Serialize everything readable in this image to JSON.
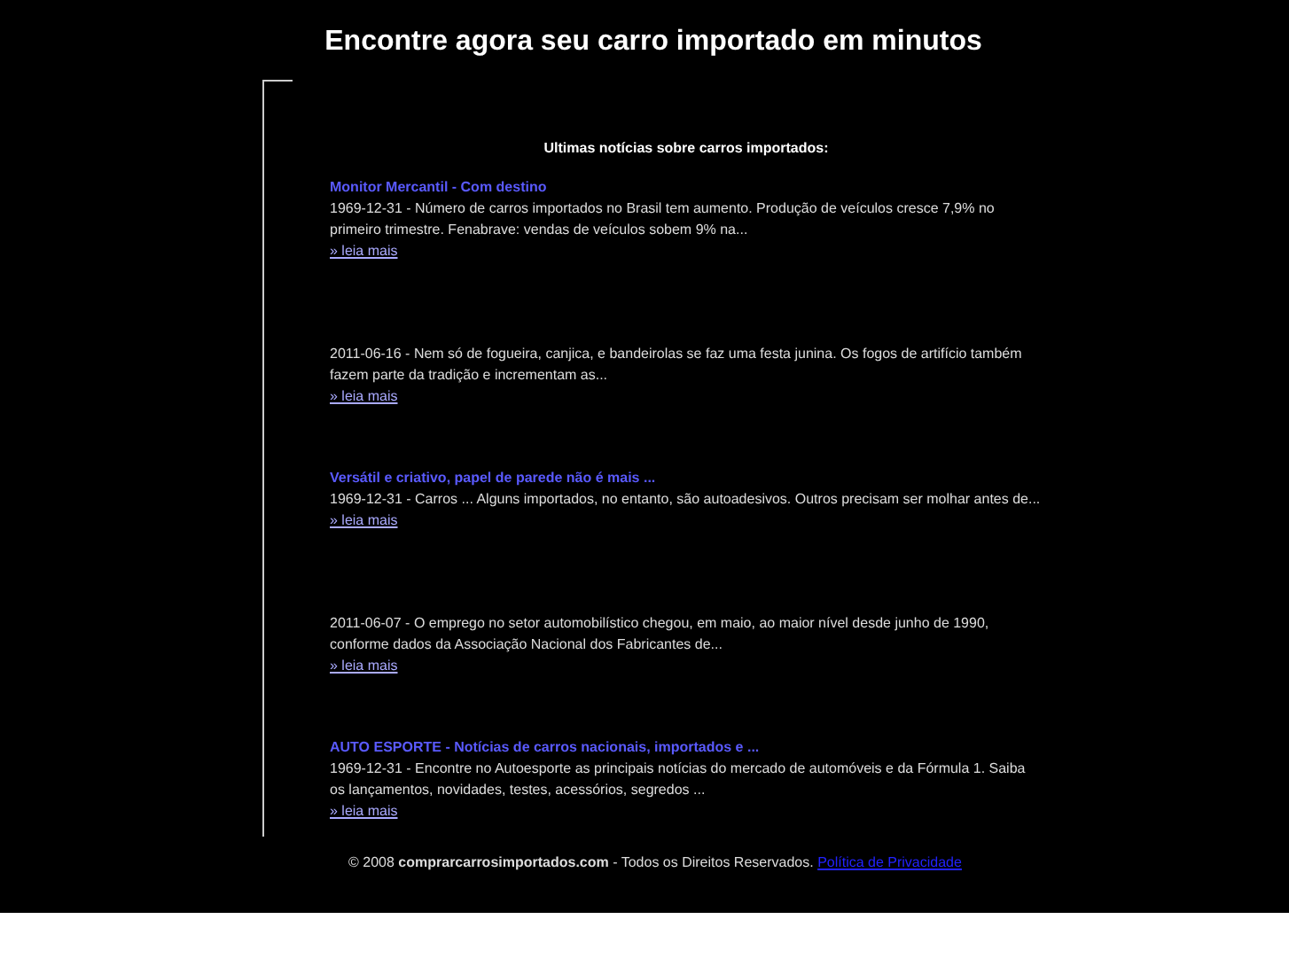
{
  "header": {
    "title": "Encontre agora seu carro importado em minutos"
  },
  "news_heading": "Ultimas notícias sobre carros importados:",
  "articles": [
    {
      "title": "Monitor Mercantil - Com destino",
      "text": "1969-12-31 - Número de carros importados no Brasil tem aumento. Produção de veículos cresce 7,9% no primeiro trimestre. Fenabrave: vendas de veículos sobem 9% na...",
      "link": "» leia mais"
    },
    {
      "text": "2011-06-16 - Nem só de fogueira, canjica, e bandeirolas se faz uma festa junina. Os fogos de artifício também fazem parte da tradição e incrementam as...",
      "link": "» leia mais"
    },
    {
      "title": "Versátil e criativo, papel de parede não é mais ...",
      "text": "1969-12-31 - Carros ... Alguns importados, no entanto, são autoadesivos. Outros precisam ser molhar antes de...",
      "link": "» leia mais"
    },
    {
      "text": "2011-06-07 - O emprego no setor automobilístico chegou, em maio, ao maior nível desde junho de 1990, conforme dados da Associação Nacional dos Fabricantes de...",
      "link": "» leia mais"
    },
    {
      "title": "AUTO ESPORTE - Notícias de carros nacionais, importados e ...",
      "text": "1969-12-31 - Encontre no Autoesporte as principais notícias do mercado de automóveis e da Fórmula 1. Saiba os lançamentos, novidades, testes, acessórios, segredos ...",
      "link": "» leia mais"
    }
  ],
  "footer": {
    "text": "© 2008 **comprarcarrosimportados.com** - Todos os Direitos Reservados.",
    "link": "Política de Privacidade"
  }
}
